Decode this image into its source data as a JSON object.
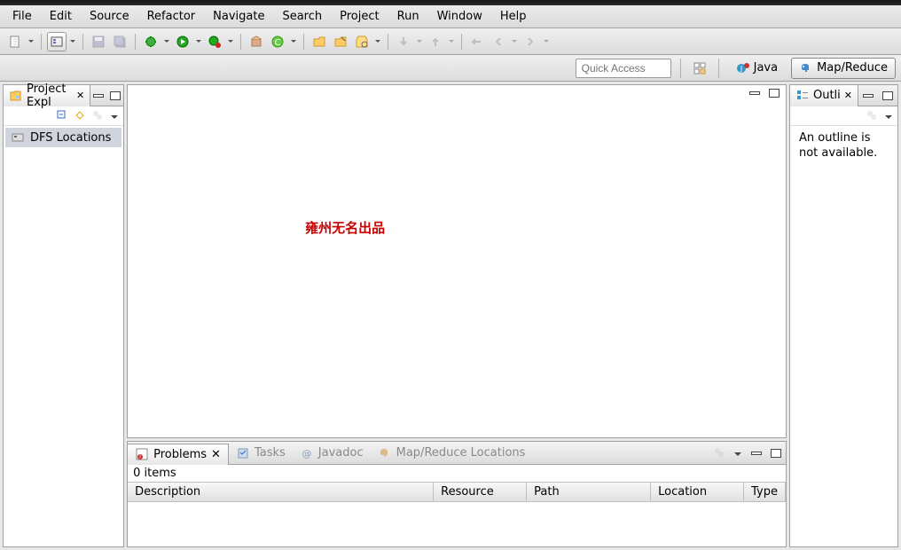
{
  "menubar": {
    "items": [
      "File",
      "Edit",
      "Source",
      "Refactor",
      "Navigate",
      "Search",
      "Project",
      "Run",
      "Window",
      "Help"
    ]
  },
  "quick_access": {
    "placeholder": "Quick Access"
  },
  "perspectives": {
    "java": "Java",
    "mapreduce": "Map/Reduce"
  },
  "project_explorer": {
    "title": "Project Expl",
    "tree_item": "DFS Locations"
  },
  "editor": {
    "watermark": "雍州无名出品"
  },
  "outline": {
    "title": "Outli",
    "message": "An outline is not available."
  },
  "bottom_panel": {
    "tabs": {
      "problems": "Problems",
      "tasks": "Tasks",
      "javadoc": "Javadoc",
      "maplocations": "Map/Reduce Locations"
    },
    "items_count": "0 items",
    "columns": {
      "description": "Description",
      "resource": "Resource",
      "path": "Path",
      "location": "Location",
      "type": "Type"
    }
  }
}
